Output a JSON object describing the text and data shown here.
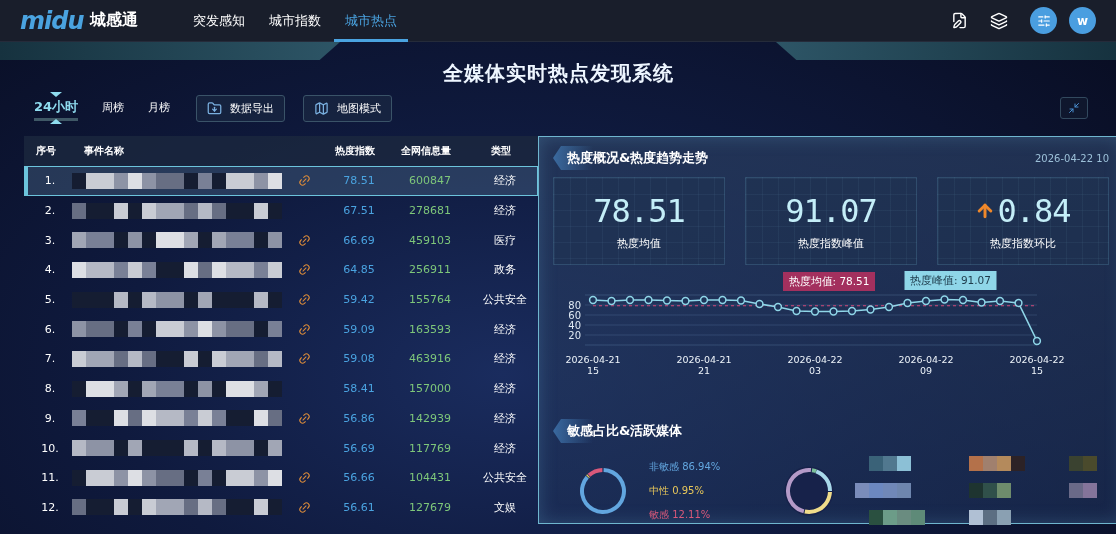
{
  "header": {
    "logo": "midu",
    "brand": "城感通",
    "nav": [
      {
        "label": "突发感知",
        "selected": false
      },
      {
        "label": "城市指数",
        "selected": false
      },
      {
        "label": "城市热点",
        "selected": true
      }
    ],
    "avatar": "w"
  },
  "title": "全媒体实时热点发现系统",
  "period_tabs": [
    {
      "label": "24小时",
      "selected": true
    },
    {
      "label": "周榜",
      "selected": false
    },
    {
      "label": "月榜",
      "selected": false
    }
  ],
  "actions": [
    {
      "label": "数据导出",
      "kind": "export"
    },
    {
      "label": "地图模式",
      "kind": "map"
    }
  ],
  "table": {
    "columns": [
      "序号",
      "事件名称",
      "热度指数",
      "全网信息量",
      "类型"
    ],
    "rows": [
      {
        "index": "1.",
        "linked": true,
        "heat": "78.51",
        "volume": "600847",
        "type": "经济",
        "selected": true
      },
      {
        "index": "2.",
        "linked": false,
        "heat": "67.51",
        "volume": "278681",
        "type": "经济",
        "selected": false
      },
      {
        "index": "3.",
        "linked": true,
        "heat": "66.69",
        "volume": "459103",
        "type": "医疗",
        "selected": false
      },
      {
        "index": "4.",
        "linked": true,
        "heat": "64.85",
        "volume": "256911",
        "type": "政务",
        "selected": false
      },
      {
        "index": "5.",
        "linked": true,
        "heat": "59.42",
        "volume": "155764",
        "type": "公共安全",
        "selected": false
      },
      {
        "index": "6.",
        "linked": true,
        "heat": "59.09",
        "volume": "163593",
        "type": "经济",
        "selected": false
      },
      {
        "index": "7.",
        "linked": true,
        "heat": "59.08",
        "volume": "463916",
        "type": "经济",
        "selected": false
      },
      {
        "index": "8.",
        "linked": false,
        "heat": "58.41",
        "volume": "157000",
        "type": "经济",
        "selected": false
      },
      {
        "index": "9.",
        "linked": true,
        "heat": "56.86",
        "volume": "142939",
        "type": "经济",
        "selected": false
      },
      {
        "index": "10.",
        "linked": false,
        "heat": "56.69",
        "volume": "117769",
        "type": "经济",
        "selected": false
      },
      {
        "index": "11.",
        "linked": true,
        "heat": "56.66",
        "volume": "104431",
        "type": "公共安全",
        "selected": false
      },
      {
        "index": "12.",
        "linked": true,
        "heat": "56.61",
        "volume": "127679",
        "type": "文娱",
        "selected": false
      }
    ]
  },
  "overview": {
    "title": "热度概况&热度趋势走势",
    "timestamp": "2026-04-22 10",
    "stats": [
      {
        "value": "78.51",
        "label": "热度均值",
        "rising": false
      },
      {
        "value": "91.07",
        "label": "热度指数峰值",
        "rising": false
      },
      {
        "value": "0.84",
        "label": "热度指数环比",
        "rising": true
      }
    ],
    "chart_data": {
      "type": "line",
      "categories": [
        "2026-04-21 15",
        null,
        null,
        null,
        null,
        null,
        "2026-04-21 21",
        null,
        null,
        null,
        null,
        null,
        "2026-04-22 03",
        null,
        null,
        null,
        null,
        null,
        "2026-04-22 09",
        null,
        null,
        null,
        null,
        null,
        "2026-04-22 15"
      ],
      "series": [
        {
          "color": "#8fd6e8",
          "marker": "circle",
          "values": [
            90,
            88,
            90,
            90,
            89,
            88,
            90,
            90,
            89,
            82,
            76,
            68,
            67,
            67,
            68,
            71,
            76,
            84,
            88,
            91,
            90,
            85,
            88,
            84,
            8
          ]
        },
        {
          "color": "#d14a7a",
          "line_style": "dashed",
          "values": [
            78.5,
            78.5,
            78.5,
            78.5,
            78.5,
            78.5,
            78.5,
            78.5,
            78.5,
            78.5,
            78.5,
            78.5,
            78.5,
            78.5,
            78.5,
            78.5,
            78.5,
            78.5,
            78.5,
            78.5,
            78.5,
            78.5,
            78.5,
            78.5,
            78.5
          ]
        }
      ],
      "ylim": [
        0,
        100
      ],
      "yticks": [
        20,
        40,
        60,
        80
      ],
      "grid": true
    },
    "mean_label": "热度均值: 78.51",
    "peak_label": "热度峰值: 91.07"
  },
  "sensitivity": {
    "title": "敏感占比&活跃媒体",
    "legend": [
      {
        "label": "非敏感",
        "value": "86.94%",
        "color": "#62a6df"
      },
      {
        "label": "中性",
        "value": "0.95%",
        "color": "#e8c75a"
      },
      {
        "label": "敏感",
        "value": "12.11%",
        "color": "#d9587a"
      }
    ]
  }
}
